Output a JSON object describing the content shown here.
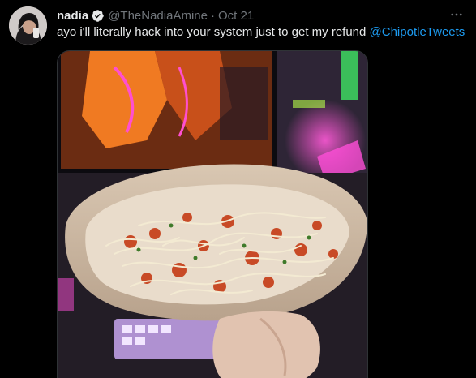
{
  "tweet": {
    "display_name": "nadia",
    "handle": "@TheNadiaAmine",
    "separator": "·",
    "timestamp": "Oct 21",
    "text": "ayo i'll literally hack into your system just to get my refund",
    "mention": "@ChipotleTweets"
  },
  "icons": {
    "verified": "verified-badge-icon",
    "more": "more-options-icon"
  },
  "colors": {
    "background": "#000000",
    "text_primary": "#e7e9ea",
    "text_secondary": "#71767b",
    "accent": "#1d9bf0"
  },
  "media_scene": "photo of a pasta burrito bowl held in front of a gaming setup"
}
